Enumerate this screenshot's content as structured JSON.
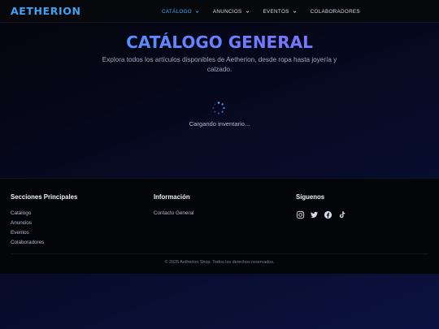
{
  "header": {
    "logo": "AETHERION",
    "nav": [
      {
        "label": "CATÁLOGO",
        "active": true,
        "has_dropdown": true
      },
      {
        "label": "ANUNCIOS",
        "active": false,
        "has_dropdown": true
      },
      {
        "label": "EVENTOS",
        "active": false,
        "has_dropdown": true
      },
      {
        "label": "COLABORADORES",
        "active": false,
        "has_dropdown": false
      }
    ]
  },
  "hero": {
    "title": "CATÁLOGO GENERAL",
    "subtitle": "Explora todos los artículos disponibles de Aetherion, desde ropa hasta joyería y calzado.",
    "loading_text": "Cargando inventario..."
  },
  "footer": {
    "sections": {
      "heading": "Secciones Principales",
      "links": [
        "Catálogo",
        "Anuncios",
        "Eventos",
        "Colaboradores"
      ]
    },
    "info": {
      "heading": "Información",
      "links": [
        "Contacto General"
      ]
    },
    "follow": {
      "heading": "Síguenos",
      "icons": [
        "instagram-icon",
        "twitter-icon",
        "facebook-icon",
        "tiktok-icon"
      ]
    },
    "copyright": "© 2025 Aetherion Shop. Todos los derechos reservados."
  },
  "colors": {
    "accent": "#3ea2f5",
    "background": "#05051a"
  }
}
